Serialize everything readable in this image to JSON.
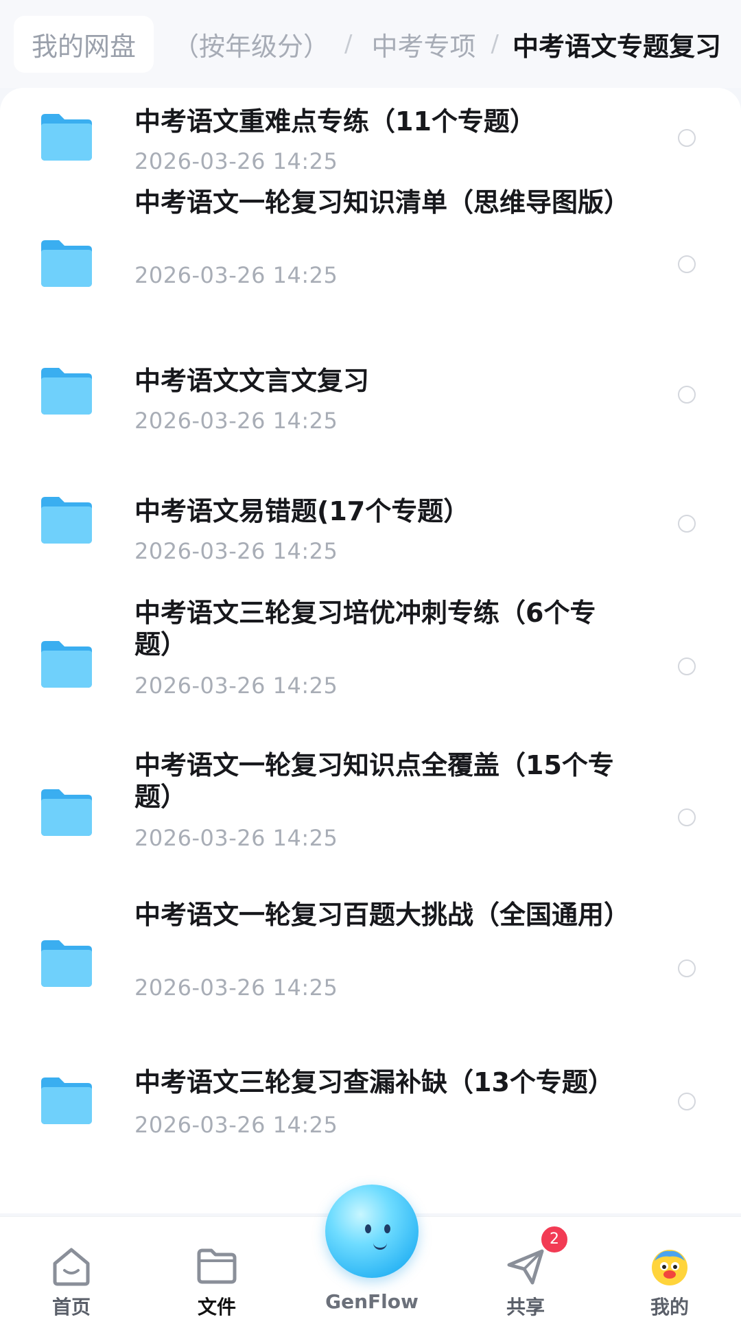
{
  "breadcrumb": {
    "root": "我的网盘",
    "level1": "（按年级分）",
    "level2": "中考专项",
    "current": "中考语文专题复习",
    "separator": "/"
  },
  "files": [
    {
      "name": "中考语文重难点专练（11个专题）",
      "date": "2026-03-26  14:25",
      "icon": "folder-icon"
    },
    {
      "name": "中考语文一轮复习知识清单（思维导图版）",
      "date": "2026-03-26  14:25",
      "icon": "folder-icon"
    },
    {
      "name": "中考语文文言文复习",
      "date": "2026-03-26  14:25",
      "icon": "folder-icon"
    },
    {
      "name": "中考语文易错题(17个专题）",
      "date": "2026-03-26  14:25",
      "icon": "folder-icon"
    },
    {
      "name": "中考语文三轮复习培优冲刺专练（6个专题）",
      "date": "2026-03-26  14:25",
      "icon": "folder-icon"
    },
    {
      "name": "中考语文一轮复习知识点全覆盖（15个专题）",
      "date": "2026-03-26  14:25",
      "icon": "folder-icon"
    },
    {
      "name": "中考语文一轮复习百题大挑战（全国通用）",
      "date": "2026-03-26  14:25",
      "icon": "folder-icon"
    },
    {
      "name": "中考语文三轮复习查漏补缺（13个专题）",
      "date": "2026-03-26  14:25",
      "icon": "folder-icon"
    }
  ],
  "nav": {
    "home": "首页",
    "files": "文件",
    "genflow": "GenFlow",
    "share": "共享",
    "share_badge": "2",
    "mine": "我的",
    "active": "files"
  },
  "colors": {
    "folder": "#3db8f5",
    "badge": "#f23b54",
    "genflow": "#2fb7f5"
  }
}
